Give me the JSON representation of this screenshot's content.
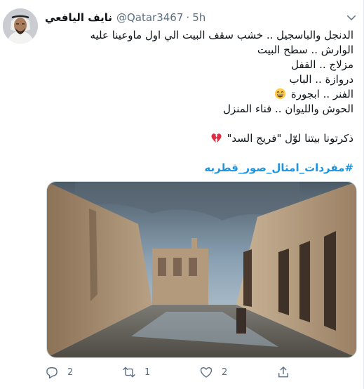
{
  "tweet": {
    "author_name": "نايف اليافعي",
    "handle": "@Qatar3467",
    "separator": "·",
    "time": "5h",
    "lines": [
      "الدنجل والباسجيل .. خشب سقف البيت الي اول ماوعينا عليه",
      "الوارش .. سطح البيت",
      "مزلاج .. القفل",
      "دروازة .. الباب",
      "الفنر .. ابجورة",
      "الحوش والليوان .. فناء المنزل",
      "",
      "ذكرتونا بيتنا لوّل \"فريج السد\""
    ],
    "hashtag": "#مفردات_امثال_صور_قطربه",
    "icons": {
      "lantern_line_emoji": "grinning-face-emoji",
      "memory_line_emoji": "broken-heart-emoji"
    }
  },
  "actions": {
    "reply_count": "2",
    "retweet_count": "1",
    "like_count": "2"
  },
  "colors": {
    "text": "#0f1419",
    "secondary": "#5b7083",
    "hashtag": "#1b95e0",
    "broken_heart": "#e0245e",
    "emoji_yellow": "#ffcc4d"
  }
}
